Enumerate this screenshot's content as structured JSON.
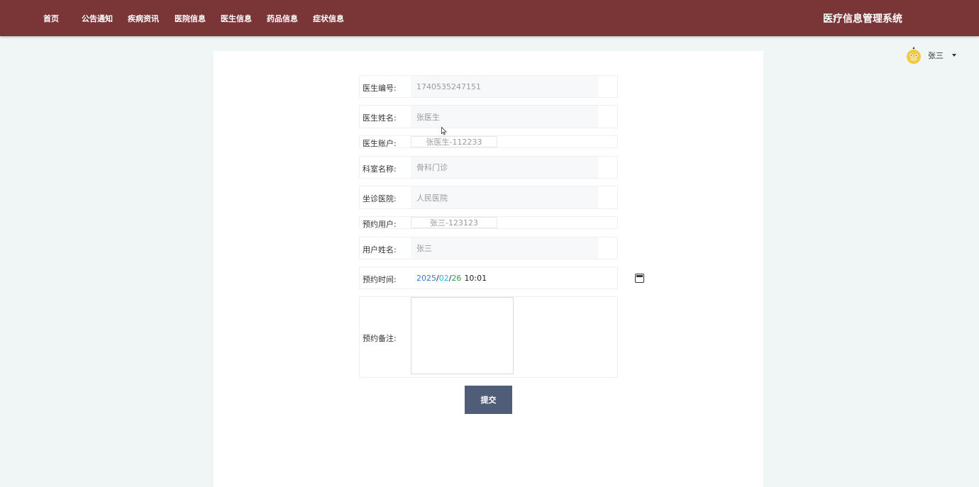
{
  "header": {
    "nav": [
      "首页",
      "公告通知",
      "疾病资讯",
      "医院信息",
      "医生信息",
      "药品信息",
      "症状信息"
    ],
    "title": "医疗信息管理系统"
  },
  "user": {
    "name": "张三",
    "avatar_icon": "psyduck-avatar-icon"
  },
  "form": {
    "doctor_id": {
      "label": "医生编号:",
      "value": "1740535247151"
    },
    "doctor_name": {
      "label": "医生姓名:",
      "value": "张医生"
    },
    "doctor_account": {
      "label": "医生账户:",
      "value": "张医生-112233"
    },
    "department": {
      "label": "科室名称:",
      "value": "骨科门诊"
    },
    "hospital": {
      "label": "坐诊医院:",
      "value": "人民医院"
    },
    "booking_user": {
      "label": "预约用户:",
      "value": "张三-123123"
    },
    "user_name": {
      "label": "用户姓名:",
      "value": "张三"
    },
    "booking_time": {
      "label": "预约时间:",
      "year": "2025",
      "month": "02",
      "day": "26",
      "sep": "/",
      "time": "10:01"
    },
    "note": {
      "label": "预约备注:",
      "value": ""
    },
    "submit_label": "提交"
  },
  "colors": {
    "header_bg": "#7a3537",
    "button_bg": "#4f5d78",
    "page_bg": "#f0f5f5"
  }
}
